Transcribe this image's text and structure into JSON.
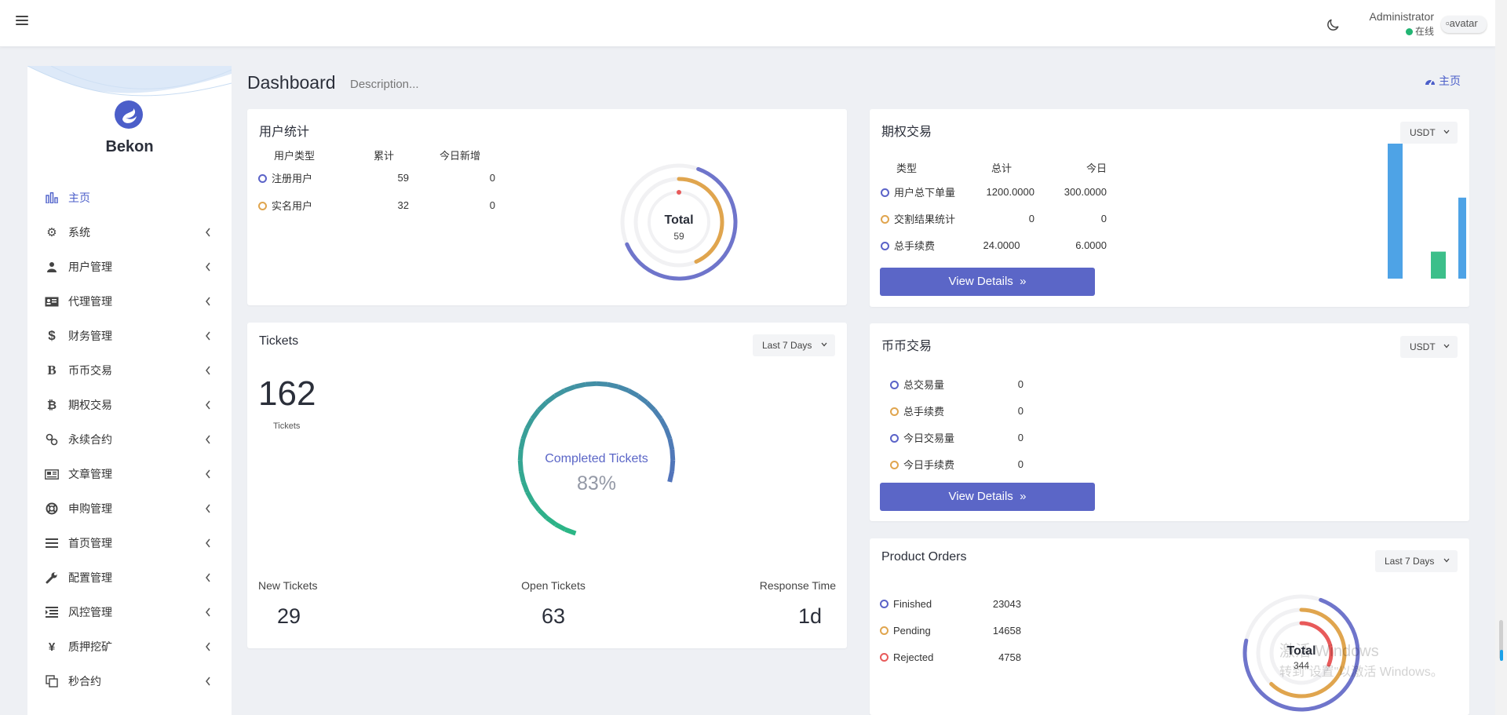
{
  "topbar": {
    "admin_name": "Administrator",
    "admin_status": "在线",
    "avatar_alt": "avatar"
  },
  "sidebar": {
    "brand": "Bekon",
    "items": [
      {
        "label": "主页",
        "icon": "bar-chart-icon",
        "active": true
      },
      {
        "label": "系统",
        "icon": "gear-icon"
      },
      {
        "label": "用户管理",
        "icon": "users-icon"
      },
      {
        "label": "代理管理",
        "icon": "id-card-icon"
      },
      {
        "label": "财务管理",
        "icon": "dollar-icon"
      },
      {
        "label": "币币交易",
        "icon": "b-letter-icon"
      },
      {
        "label": "期权交易",
        "icon": "bitcoin-icon"
      },
      {
        "label": "永续合约",
        "icon": "link-icon"
      },
      {
        "label": "文章管理",
        "icon": "newspaper-icon"
      },
      {
        "label": "申购管理",
        "icon": "lifebuoy-icon"
      },
      {
        "label": "首页管理",
        "icon": "list-icon"
      },
      {
        "label": "配置管理",
        "icon": "wrench-icon"
      },
      {
        "label": "风控管理",
        "icon": "indent-icon"
      },
      {
        "label": "质押挖矿",
        "icon": "yen-icon"
      },
      {
        "label": "秒合约",
        "icon": "copy-icon"
      }
    ]
  },
  "page": {
    "title": "Dashboard",
    "description": "Description...",
    "home_link": "主页"
  },
  "user_stats": {
    "title": "用户统计",
    "headers": [
      "用户类型",
      "累计",
      "今日新增"
    ],
    "rows": [
      {
        "label": "注册用户",
        "total": "59",
        "today": "0",
        "color": "blue"
      },
      {
        "label": "实名用户",
        "total": "32",
        "today": "0",
        "color": "orange"
      }
    ],
    "donut_label": "Total",
    "donut_value": "59"
  },
  "options_trading": {
    "title": "期权交易",
    "currency": "USDT",
    "headers": [
      "类型",
      "总计",
      "今日"
    ],
    "rows": [
      {
        "label": "用户总下单量",
        "total": "1200.0000",
        "today": "300.0000",
        "color": "blue"
      },
      {
        "label": "交割结果统计",
        "total": "0",
        "today": "0",
        "color": "orange"
      },
      {
        "label": "总手续费",
        "total": "24.0000",
        "today": "6.0000",
        "color": "blue"
      }
    ],
    "button": "View Details"
  },
  "tickets": {
    "title": "Tickets",
    "range": "Last 7 Days",
    "count": "162",
    "count_label": "Tickets",
    "gauge_label": "Completed Tickets",
    "gauge_value": "83%",
    "gauge_fraction": 0.83,
    "stats": [
      {
        "label": "New Tickets",
        "value": "29"
      },
      {
        "label": "Open Tickets",
        "value": "63"
      },
      {
        "label": "Response Time",
        "value": "1d"
      }
    ]
  },
  "coin_trading": {
    "title": "币币交易",
    "currency": "USDT",
    "rows": [
      {
        "label": "总交易量",
        "value": "0",
        "color": "blue"
      },
      {
        "label": "总手续费",
        "value": "0",
        "color": "orange"
      },
      {
        "label": "今日交易量",
        "value": "0",
        "color": "blue"
      },
      {
        "label": "今日手续费",
        "value": "0",
        "color": "orange"
      }
    ],
    "button": "View Details"
  },
  "product_orders": {
    "title": "Product Orders",
    "range": "Last 7 Days",
    "rows": [
      {
        "label": "Finished",
        "value": "23043",
        "color": "blue"
      },
      {
        "label": "Pending",
        "value": "14658",
        "color": "orange"
      },
      {
        "label": "Rejected",
        "value": "4758",
        "color": "red"
      }
    ],
    "donut_label": "Total",
    "donut_value": "344"
  },
  "watermark": {
    "line1": "激活 Windows",
    "line2": "转到\"设置\"以激活 Windows。"
  },
  "colors": {
    "primary": "#5b66c7",
    "blue": "#5b63c8",
    "orange": "#e0a54e",
    "red": "#e85a5a",
    "green": "#2bb685",
    "bar_blue": "#4ea3e6"
  },
  "chart_data": [
    {
      "type": "bar",
      "categories": [
        "用户总下单量",
        "交割结果统计",
        "总手续费"
      ],
      "values": [
        1200,
        240,
        720
      ],
      "colors": [
        "#4ea3e6",
        "#3cbf8a",
        "#4ea3e6"
      ]
    }
  ]
}
